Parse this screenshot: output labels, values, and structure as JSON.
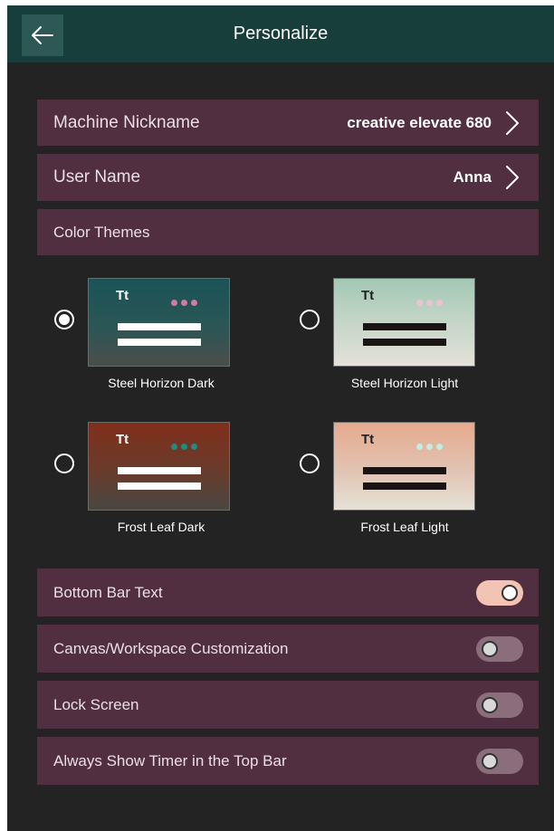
{
  "header": {
    "title": "Personalize",
    "back_icon": "arrow-left-icon"
  },
  "settings": {
    "nickname": {
      "label": "Machine Nickname",
      "value": "creative elevate 680"
    },
    "username": {
      "label": "User Name",
      "value": "Anna"
    },
    "themes_label": "Color Themes"
  },
  "themes": [
    {
      "name": "Steel Horizon Dark",
      "selected": true,
      "tt": "Tt"
    },
    {
      "name": "Steel Horizon Light",
      "selected": false,
      "tt": "Tt"
    },
    {
      "name": "Frost Leaf Dark",
      "selected": false,
      "tt": "Tt"
    },
    {
      "name": "Frost Leaf Light",
      "selected": false,
      "tt": "Tt"
    }
  ],
  "toggles": [
    {
      "label": "Bottom Bar Text",
      "on": true
    },
    {
      "label": "Canvas/Workspace Customization",
      "on": false
    },
    {
      "label": "Lock Screen",
      "on": false
    },
    {
      "label": "Always Show Timer in the Top Bar",
      "on": false
    }
  ],
  "colors": {
    "topbar": "#173e3b",
    "row": "#512f40",
    "background": "#232323",
    "toggle_on": "#f3c3b3",
    "toggle_off": "#8b6e7b"
  }
}
